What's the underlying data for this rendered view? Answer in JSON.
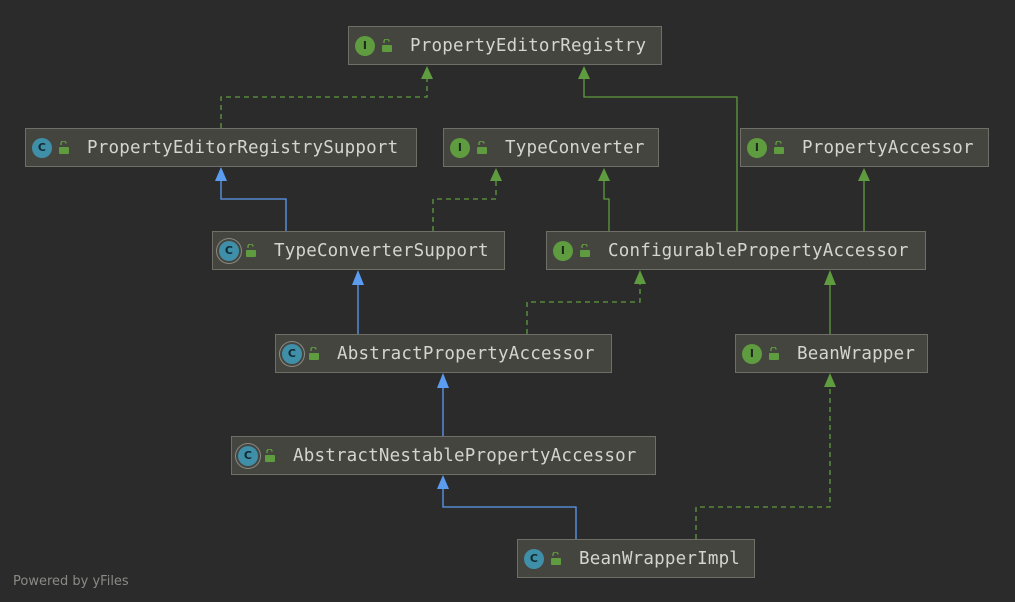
{
  "diagram": {
    "nodes": [
      {
        "id": "n1",
        "kind": "interface",
        "badge": "I",
        "name": "PropertyEditorRegistry"
      },
      {
        "id": "n2",
        "kind": "class",
        "badge": "C",
        "name": "PropertyEditorRegistrySupport"
      },
      {
        "id": "n3",
        "kind": "interface",
        "badge": "I",
        "name": "TypeConverter"
      },
      {
        "id": "n4",
        "kind": "interface",
        "badge": "I",
        "name": "PropertyAccessor"
      },
      {
        "id": "n5",
        "kind": "abstract",
        "badge": "C",
        "name": "TypeConverterSupport"
      },
      {
        "id": "n6",
        "kind": "interface",
        "badge": "I",
        "name": "ConfigurablePropertyAccessor"
      },
      {
        "id": "n7",
        "kind": "abstract",
        "badge": "C",
        "name": "AbstractPropertyAccessor"
      },
      {
        "id": "n8",
        "kind": "interface",
        "badge": "I",
        "name": "BeanWrapper"
      },
      {
        "id": "n9",
        "kind": "abstract",
        "badge": "C",
        "name": "AbstractNestablePropertyAccessor"
      },
      {
        "id": "n10",
        "kind": "class",
        "badge": "C",
        "name": "BeanWrapperImpl"
      }
    ],
    "edges": [
      {
        "from": "n2",
        "to": "n1",
        "type": "implements"
      },
      {
        "from": "n5",
        "to": "n2",
        "type": "extends"
      },
      {
        "from": "n5",
        "to": "n3",
        "type": "implements"
      },
      {
        "from": "n6",
        "to": "n1",
        "type": "interface-extends"
      },
      {
        "from": "n6",
        "to": "n3",
        "type": "interface-extends"
      },
      {
        "from": "n6",
        "to": "n4",
        "type": "interface-extends"
      },
      {
        "from": "n7",
        "to": "n5",
        "type": "extends"
      },
      {
        "from": "n7",
        "to": "n6",
        "type": "implements"
      },
      {
        "from": "n8",
        "to": "n6",
        "type": "interface-extends"
      },
      {
        "from": "n9",
        "to": "n7",
        "type": "extends"
      },
      {
        "from": "n10",
        "to": "n9",
        "type": "extends"
      },
      {
        "from": "n10",
        "to": "n8",
        "type": "implements"
      }
    ],
    "colors": {
      "extends": "#5b9bf0",
      "implements": "#5f9b3f",
      "interface-extends": "#5f9b3f",
      "interface_badge": "#5f9b3f",
      "class_badge": "#3f8fa8"
    }
  },
  "footer": "Powered by yFiles"
}
